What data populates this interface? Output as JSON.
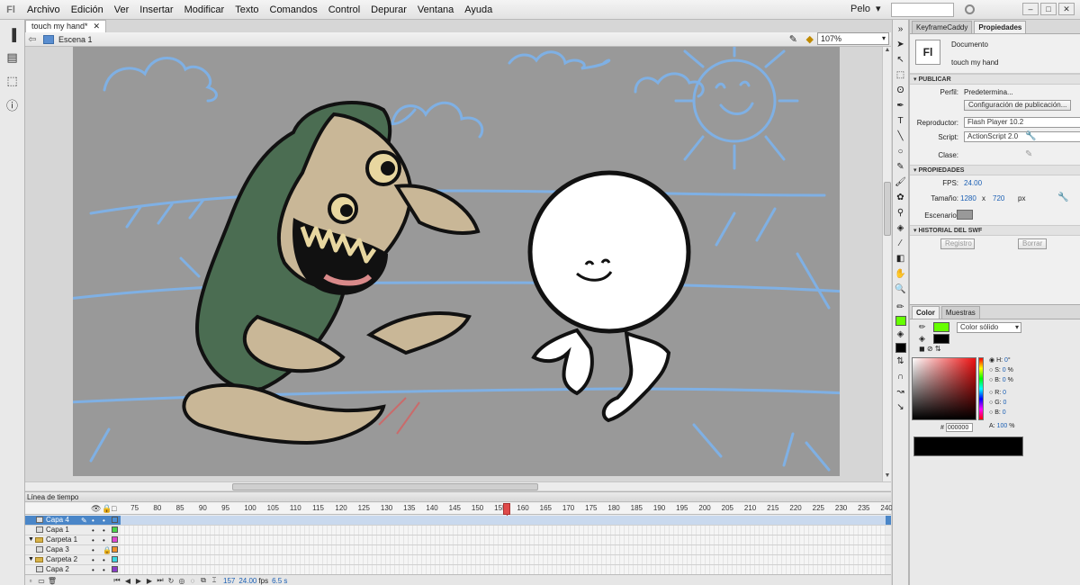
{
  "app": {
    "logo": "Fl"
  },
  "menu": [
    "Archivo",
    "Edición",
    "Ver",
    "Insertar",
    "Modificar",
    "Texto",
    "Comandos",
    "Control",
    "Depurar",
    "Ventana",
    "Ayuda"
  ],
  "workspace": {
    "label": "Pelo",
    "dropdown_icon": "chevron-down-icon"
  },
  "document": {
    "tab_title": "touch my hand*",
    "scene": "Escena 1",
    "zoom": "107%"
  },
  "timeline": {
    "title": "Línea de tiempo",
    "ruler": [
      "75",
      "80",
      "85",
      "90",
      "95",
      "100",
      "105",
      "110",
      "115",
      "120",
      "125",
      "130",
      "135",
      "140",
      "145",
      "150",
      "155",
      "160",
      "165",
      "170",
      "175",
      "180",
      "185",
      "190",
      "195",
      "200",
      "205",
      "210",
      "215",
      "220",
      "225",
      "230",
      "235",
      "240"
    ],
    "layers": [
      {
        "name": "Capa 4",
        "type": "layer",
        "color": "#4a8fd6",
        "active": true
      },
      {
        "name": "Capa 1",
        "type": "layer",
        "color": "#49d44a",
        "active": false
      },
      {
        "name": "Carpeta 1",
        "type": "folder",
        "color": "#e046d0",
        "active": false
      },
      {
        "name": "Capa 3",
        "type": "layer",
        "color": "#f0902a",
        "active": false
      },
      {
        "name": "Carpeta 2",
        "type": "folder",
        "color": "#3ad6e0",
        "active": false
      },
      {
        "name": "Capa 2",
        "type": "layer",
        "color": "#8a3cc8",
        "active": false
      }
    ],
    "current_frame": "157",
    "fps": "24.00",
    "fps_unit": "fps",
    "elapsed": "6.5 s",
    "playhead_frame": 157
  },
  "properties": {
    "tabs": [
      "KeyframeCaddy",
      "Propiedades"
    ],
    "doc_badge": "Fl",
    "doc_type": "Documento",
    "doc_name": "touch my hand",
    "publish": {
      "section": "PUBLICAR",
      "profile_label": "Perfil:",
      "profile_value": "Predetermina...",
      "publish_settings_button": "Configuración de publicación...",
      "player_label": "Reproductor:",
      "player_value": "Flash Player 10.2",
      "script_label": "Script:",
      "script_value": "ActionScript 2.0",
      "class_label": "Clase:"
    },
    "props": {
      "section": "PROPIEDADES",
      "fps_label": "FPS:",
      "fps_value": "24.00",
      "size_label": "Tamaño:",
      "width": "1280",
      "x": "x",
      "height": "720",
      "unit": "px",
      "stage_label": "Escenario:",
      "stage_color": "#999999"
    },
    "swf": {
      "section": "HISTORIAL DEL SWF",
      "log_button": "Registro",
      "clear_button": "Borrar"
    }
  },
  "color_panel": {
    "tabs": [
      "Color",
      "Muestras"
    ],
    "type": "Color sólido",
    "stroke_color": "#66ff00",
    "fill_color": "#000000",
    "H": "0",
    "H_unit": "°",
    "S": "0",
    "S_unit": "%",
    "B": "0",
    "B_unit": "%",
    "R": "0",
    "G": "0",
    "Bc": "0",
    "hex_label": "#",
    "hex": "000000",
    "A": "100",
    "A_unit": "%",
    "labels": {
      "H": "H:",
      "S": "S:",
      "B": "B:",
      "R": "R:",
      "G": "G:",
      "Bc": "B:",
      "A": "A:"
    }
  }
}
